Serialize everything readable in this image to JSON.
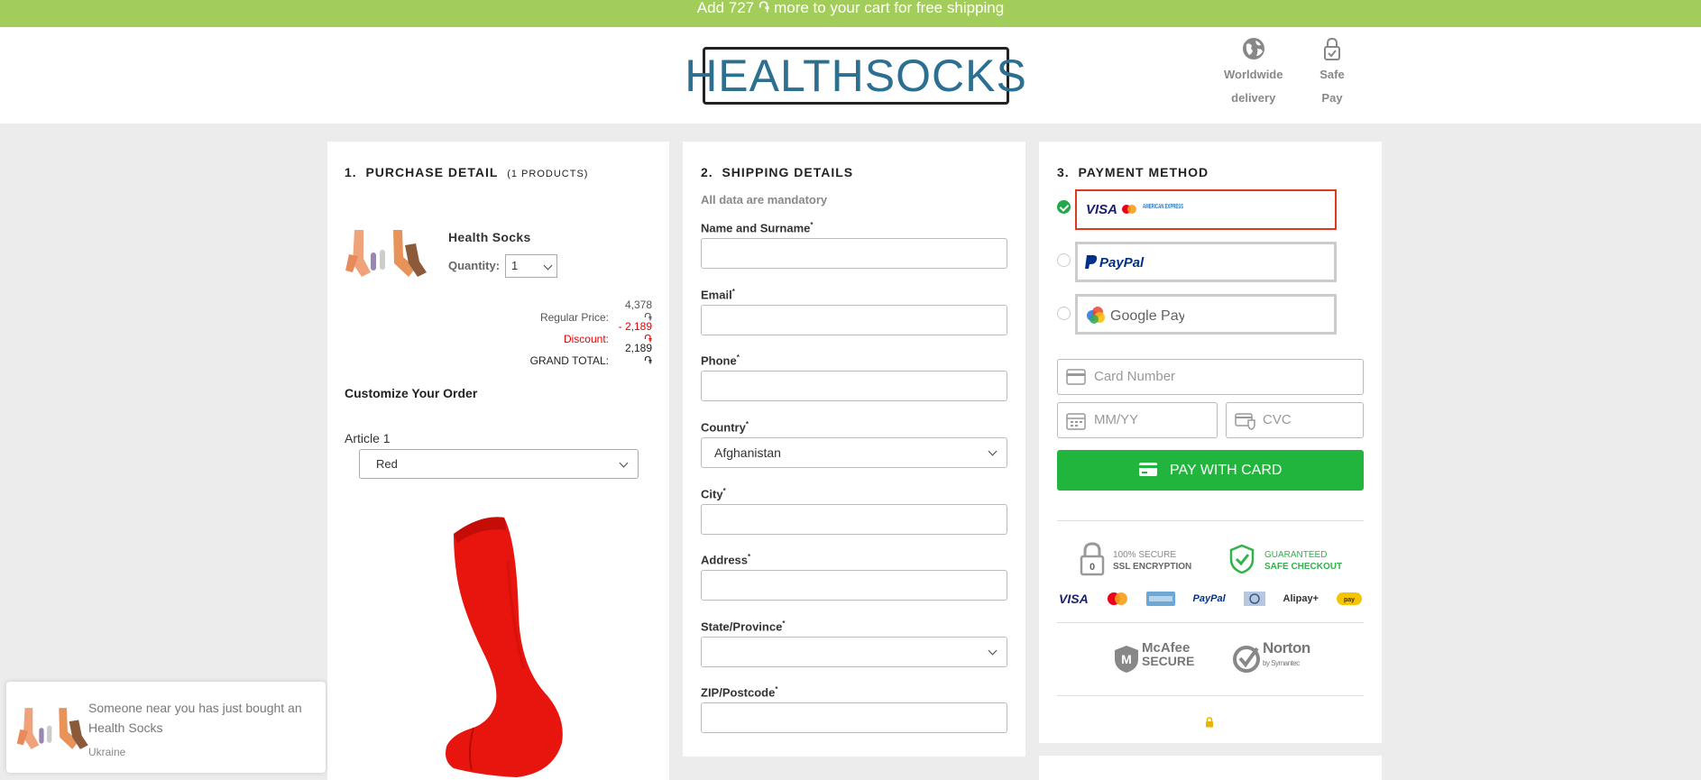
{
  "topbar": {
    "text": "Add 727 ֏ more to your cart for free shipping"
  },
  "header": {
    "logo_text": "HEALTHSOCKS",
    "features": [
      {
        "icon": "globe-icon",
        "line1": "Worldwide",
        "line2": "delivery"
      },
      {
        "icon": "lock-icon",
        "line1": "Safe",
        "line2": "Pay"
      }
    ]
  },
  "purchase": {
    "num": "1.",
    "title": "PURCHASE DETAIL",
    "count": "(1 PRODUCTS)",
    "product_name": "Health Socks",
    "quantity_label": "Quantity:",
    "quantity_value": "1",
    "regular_label": "Regular Price:",
    "regular_value": "4,378 ֏",
    "discount_label": "Discount:",
    "discount_value": "- 2,189 ֏",
    "grand_label": "GRAND TOTAL:",
    "grand_value": "2,189 ֏",
    "customize_title": "Customize Your Order",
    "article_label": "Article 1",
    "article_value": "Red",
    "sock_color": "#e8150f"
  },
  "shipping": {
    "num": "2.",
    "title": "SHIPPING DETAILS",
    "mandatory": "All data are mandatory",
    "fields": [
      {
        "label": "Name and Surname",
        "value": ""
      },
      {
        "label": "Email",
        "value": ""
      },
      {
        "label": "Phone",
        "value": ""
      },
      {
        "label": "Country",
        "value": "Afghanistan"
      },
      {
        "label": "City",
        "value": ""
      },
      {
        "label": "Address",
        "value": ""
      },
      {
        "label": "State/Province",
        "value": ""
      },
      {
        "label": "ZIP/Postcode",
        "value": ""
      }
    ]
  },
  "payment": {
    "num": "3.",
    "title": "PAYMENT METHOD",
    "options": [
      {
        "name": "cards",
        "labels": [
          "VISA",
          "AMERICAN EXPRESS"
        ],
        "selected": true
      },
      {
        "name": "paypal",
        "label": "PayPal",
        "selected": false
      },
      {
        "name": "googlepay",
        "label": "Google Pay",
        "selected": false
      }
    ],
    "card_number_placeholder": "Card Number",
    "expiry_placeholder": "MM/YY",
    "cvc_placeholder": "CVC",
    "pay_button": "PAY WITH CARD",
    "trust": {
      "ssl_line1": "100% SECURE",
      "ssl_line2": "SSL ENCRYPTION",
      "guar_line1": "GUARANTEED",
      "guar_line2": "SAFE CHECKOUT",
      "logos": [
        "VISA",
        "PayPal",
        "Alipay+"
      ]
    },
    "mcafee_line1": "McAfee",
    "mcafee_line2": "SECURE",
    "norton_main": "Norton",
    "norton_sub": "by Symantec",
    "accent": "#22b53e"
  },
  "toast": {
    "message": "Someone near you has just bought an Health Socks",
    "location": "Ukraine"
  }
}
